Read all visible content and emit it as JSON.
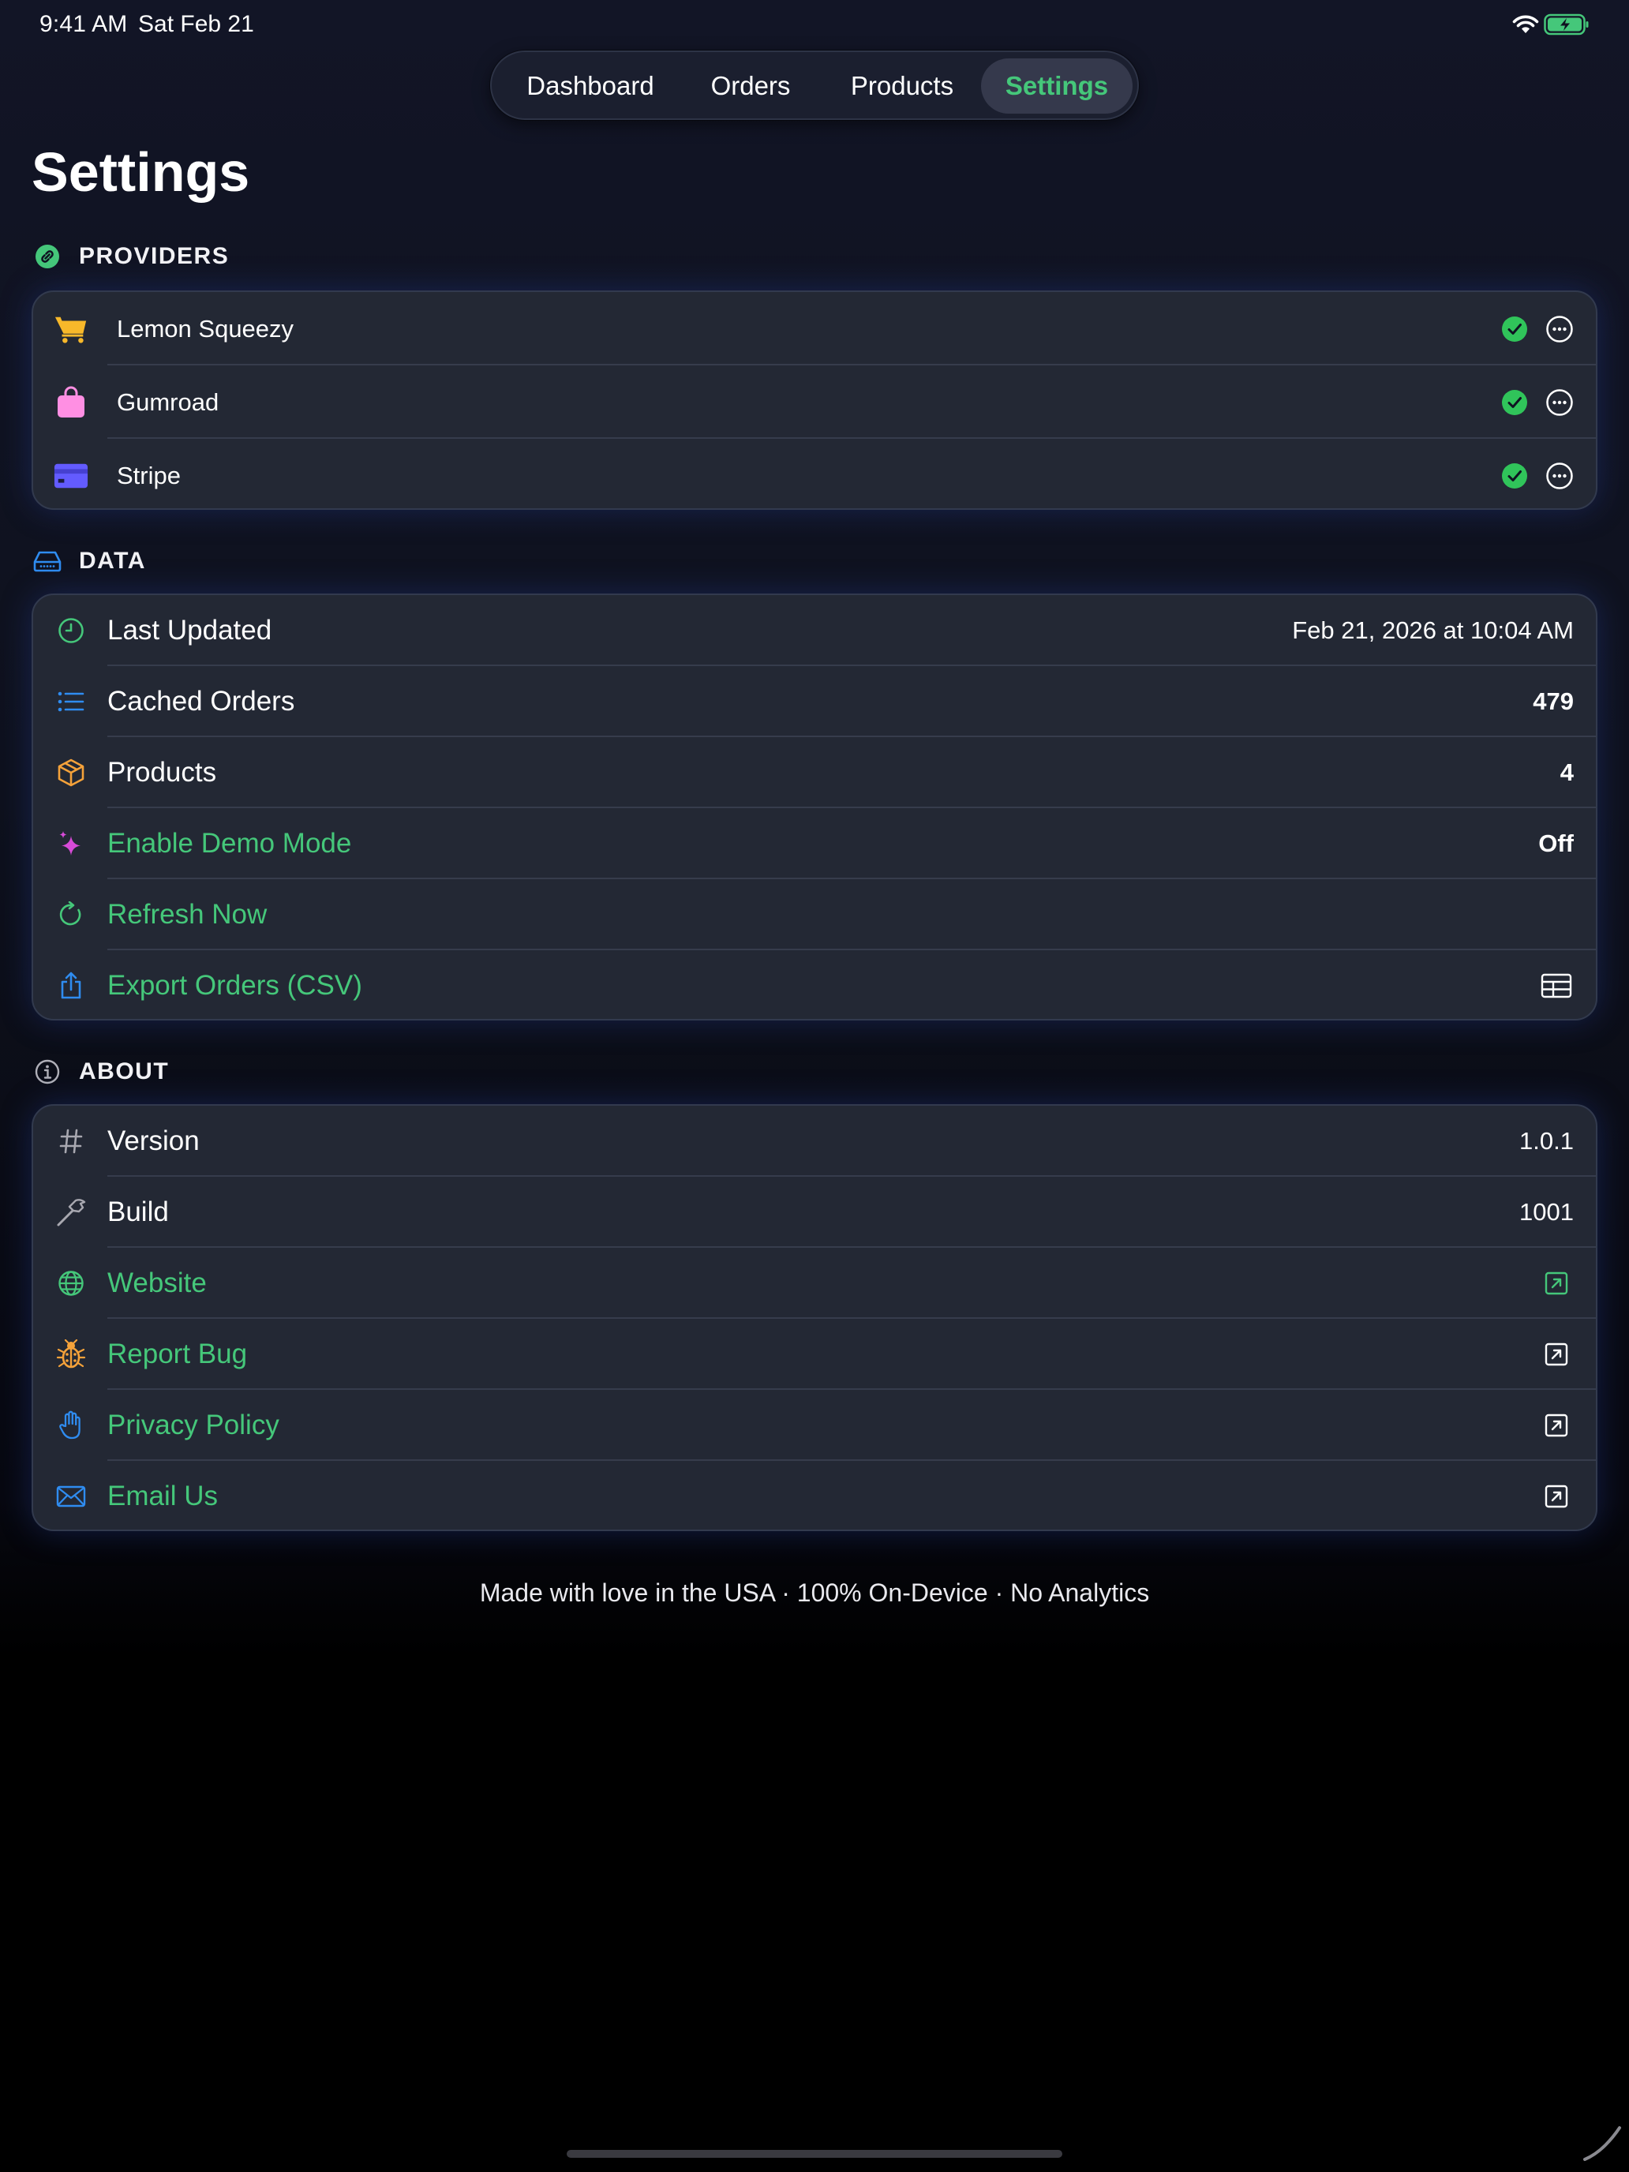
{
  "status_bar": {
    "time": "9:41 AM",
    "date": "Sat Feb 21"
  },
  "tabs": [
    {
      "label": "Dashboard",
      "selected": false
    },
    {
      "label": "Orders",
      "selected": false
    },
    {
      "label": "Products",
      "selected": false
    },
    {
      "label": "Settings",
      "selected": true
    }
  ],
  "page_title": "Settings",
  "sections": {
    "providers": {
      "title": "PROVIDERS",
      "icon": "link-icon",
      "items": [
        {
          "label": "Lemon Squeezy",
          "icon": "cart-icon",
          "connected": true
        },
        {
          "label": "Gumroad",
          "icon": "bag-icon",
          "connected": true
        },
        {
          "label": "Stripe",
          "icon": "credit-card-icon",
          "connected": true
        }
      ]
    },
    "data": {
      "title": "DATA",
      "icon": "drive-icon",
      "items": [
        {
          "label": "Last Updated",
          "value": "Feb 21, 2026 at 10:04 AM",
          "icon": "clock-icon"
        },
        {
          "label": "Cached Orders",
          "value": "479",
          "icon": "list-icon"
        },
        {
          "label": "Products",
          "value": "4",
          "icon": "box-icon"
        },
        {
          "label": "Enable Demo Mode",
          "value": "Off",
          "icon": "sparkles-icon"
        },
        {
          "label": "Refresh Now",
          "icon": "refresh-icon"
        },
        {
          "label": "Export Orders (CSV)",
          "icon": "share-icon",
          "trailing_icon": "table-icon"
        }
      ]
    },
    "about": {
      "title": "ABOUT",
      "icon": "info-icon",
      "items": [
        {
          "label": "Version",
          "value": "1.0.1",
          "icon": "number-sign-icon"
        },
        {
          "label": "Build",
          "value": "1001",
          "icon": "hammer-icon"
        },
        {
          "label": "Website",
          "icon": "globe-icon",
          "trailing_icon": "external-link-icon"
        },
        {
          "label": "Report Bug",
          "icon": "ladybug-icon",
          "trailing_icon": "external-link-icon"
        },
        {
          "label": "Privacy Policy",
          "icon": "hand-icon",
          "trailing_icon": "external-link-icon"
        },
        {
          "label": "Email Us",
          "icon": "envelope-icon",
          "trailing_icon": "external-link-icon"
        }
      ]
    }
  },
  "footer": "Made with love in the USA · 100% On-Device · No Analytics",
  "colors": {
    "accent_green": "#45c77a",
    "background": "#121526",
    "card": "#232834",
    "lemon_squeezy": "#f7b82a",
    "gumroad": "#ff8fe3",
    "stripe": "#635bff",
    "blue_icon": "#2f8cf0",
    "orange_icon": "#f5a23a",
    "purple_icon": "#d74bd8"
  }
}
